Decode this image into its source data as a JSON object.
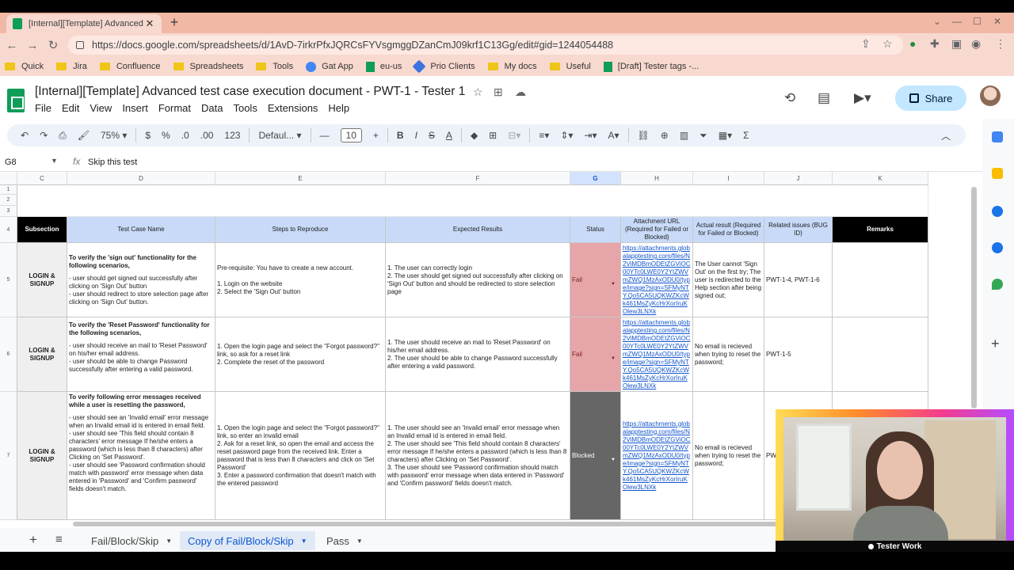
{
  "browser": {
    "tab_title": "[Internal][Template] Advanced te",
    "url": "https://docs.google.com/spreadsheets/d/1AvD-7irkrPfxJQRCsFYVsgmggDZanCmJ09krf1C13Gg/edit#gid=1244054488",
    "bookmarks": [
      "Quick",
      "Jira",
      "Confluence",
      "Spreadsheets",
      "Tools",
      "Gat App",
      "eu-us",
      "Prio Clients",
      "My docs",
      "Useful",
      "[Draft] Tester tags -..."
    ]
  },
  "doc": {
    "title": "[Internal][Template] Advanced test case execution document - PWT-1 - Tester 1",
    "menus": [
      "File",
      "Edit",
      "View",
      "Insert",
      "Format",
      "Data",
      "Tools",
      "Extensions",
      "Help"
    ],
    "share_label": "Share"
  },
  "toolbar": {
    "zoom": "75%",
    "currency": "$",
    "percent": "%",
    "dec_less": ".0",
    "dec_more": ".00",
    "number_format": "123",
    "font": "Defaul...",
    "font_size": "10"
  },
  "formula_bar": {
    "name_box": "G8",
    "fx": "fx",
    "value": "Skip this test"
  },
  "grid": {
    "columns": [
      "C",
      "D",
      "E",
      "F",
      "G",
      "H",
      "I",
      "J",
      "K"
    ],
    "row_numbers": [
      "1",
      "2",
      "3",
      "4",
      "5",
      "6",
      "7"
    ],
    "headers": {
      "subsection": "Subsection",
      "test_case": "Test Case Name",
      "steps": "Steps to Reproduce",
      "expected": "Expected Results",
      "status": "Status",
      "attachment": "Attachment URL (Required for Failed or Blocked)",
      "actual": "Actual result (Required for Failed or Blocked)",
      "related": "Related issues (BUG ID)",
      "remarks": "Remarks"
    },
    "rows": [
      {
        "subsection": "LOGIN & SIGNUP",
        "test_case_title": "To verify the 'sign out' functionality for the following scenarios,",
        "test_case_body": "- user should get signed out successfully after clicking on 'Sign Out' button\n- user should redirect to store selection page after clicking on 'Sign Out' button.",
        "steps": "Pre-requisite: You have to create a new account.\n\n1. Login on the website\n2. Select the 'Sign Out' button",
        "expected": "1. The user can correctly login\n2. The user should get signed out successfully after clicking on 'Sign Out' button and should be redirected to store selection page",
        "status": "Fail",
        "attachment": "https://attachments.globalapptesting.com/files/N2ViMDBmODEtZGViOC00YTc0LWE0Y2YtZWVmZWQ1MzAxODU0/type/image?sign=SFMyNTY.Qo5CA5UQKWZKcWk461MsZyKcHrXorIruKOlew3LNXk",
        "actual": "The User cannot 'Sign Out' on the first try; The user is redirected to the Help section after being signed out;",
        "related": "PWT-1-4, PWT-1-6",
        "remarks": ""
      },
      {
        "subsection": "LOGIN & SIGNUP",
        "test_case_title": "To verify the 'Reset Password' functionality for the following scenarios,",
        "test_case_body": "- user should receive an mail to 'Reset Password' on his/her email address.\n- user should be able to change Password successfully after entering a valid password.",
        "steps": "1. Open the login page and select the \"Forgot password?\" link, so ask for a reset link\n2. Complete the reset of the password",
        "expected": "1. The user should receive an mail to 'Reset Password' on his/her email address.\n2. The user should be able to change Password successfully after entering a valid password.",
        "status": "Fail",
        "attachment": "https://attachments.globalapptesting.com/files/N2ViMDBmODEtZGViOC00YTc0LWE0Y2YtZWVmZWQ1MzAxODU0/type/image?sign=SFMyNTY.Qo5CA5UQKWZKcWk461MsZyKcHrXorIruKOlew3LNXk",
        "actual": "No email is recieved when trying to reset the password;",
        "related": "PWT-1-5",
        "remarks": ""
      },
      {
        "subsection": "LOGIN & SIGNUP",
        "test_case_title": "To verify following error messages received while a user is resetting the password,",
        "test_case_body": "- user should see an 'Invalid email' error message when an Invalid email id is entered in email field.\n- user should see 'This field should contain 8 characters' error message If he/she enters a password (which is less than 8 characters) after Clicking on 'Set Password'.\n- user should see 'Password confirmation should match with password' error message when data entered in 'Password' and 'Confirm password' fields doesn't match.",
        "steps": "1. Open the login page and select the \"Forgot password?\" link, so enter an invalid email\n2. Ask for a reset link, so open the email and access the reset password page from the received link. Enter a password that is less than 8 characters and click on 'Set Password'\n3. Enter a password confirmation that doesn't match with the entered password",
        "expected": "1. The user should see an 'Invalid email' error message when an Invalid email id is entered in email field.\n2. The user should see 'This field should contain 8 characters' error message If he/she enters a password (which is less than 8 characters) after Clicking on 'Set Password'.\n3. The user should see 'Password confirmation should match with password' error message when data entered in 'Password' and 'Confirm password' fields doesn't match.",
        "status": "Blocked",
        "attachment": "https://attachments.globalapptesting.com/files/N2ViMDBmODEtZGViOC00YTc0LWE0Y2YtZWVmZWQ1MzAxODU0/type/image?sign=SFMyNTY.Qo5CA5UQKWZKcWk461MsZyKcHrXorIruKOlew3LNXk",
        "actual": "No email is recieved when trying to reset the password;",
        "related": "PW",
        "remarks": ""
      }
    ]
  },
  "sheet_tabs": [
    "Fail/Block/Skip",
    "Copy of Fail/Block/Skip",
    "Pass"
  ],
  "webcam": {
    "label": "Tester Work"
  },
  "colors": {
    "fail": "#e6a5a8",
    "blocked": "#666666",
    "header_blue": "#c9daf8",
    "accent": "#0b57d0",
    "share_bg": "#c2e7ff"
  },
  "icons": [
    "back-icon",
    "forward-icon",
    "reload-icon",
    "star-icon",
    "undo-icon",
    "redo-icon",
    "print-icon",
    "paint-format-icon",
    "bold-icon",
    "italic-icon",
    "strikethrough-icon",
    "text-color-icon",
    "fill-color-icon",
    "borders-icon",
    "merge-icon",
    "align-icon",
    "link-icon",
    "comment-icon",
    "chart-icon",
    "filter-icon",
    "functions-icon",
    "history-icon",
    "meet-icon"
  ]
}
